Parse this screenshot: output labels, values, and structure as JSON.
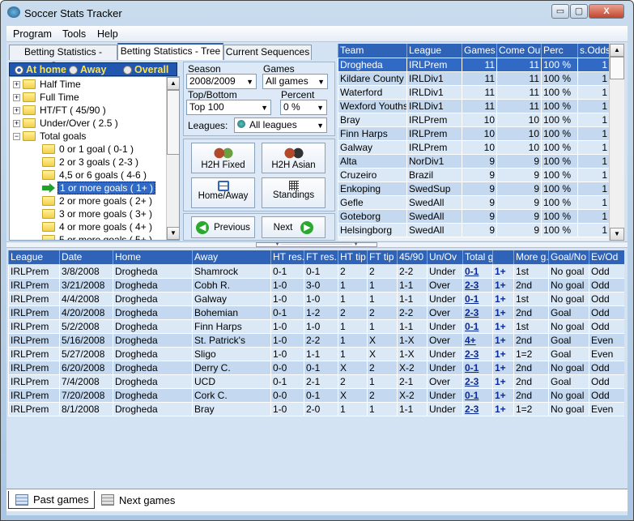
{
  "window": {
    "title": "Soccer Stats Tracker",
    "minimize": "▭",
    "maximize": "▢",
    "close": "X"
  },
  "menu": [
    "Program",
    "Tools",
    "Help"
  ],
  "tabs": [
    "Betting Statistics - Query",
    "Betting Statistics - Tree",
    "Current Sequences"
  ],
  "active_tab": 1,
  "venue": {
    "options": [
      "At home",
      "Away",
      "Overall"
    ],
    "selected": "At home"
  },
  "tree": [
    {
      "label": "Half Time",
      "level": 0,
      "expander": "+"
    },
    {
      "label": "Full Time",
      "level": 0,
      "expander": "+"
    },
    {
      "label": "HT/FT  ( 45/90 )",
      "level": 0,
      "expander": "+"
    },
    {
      "label": "Under/Over ( 2.5 )",
      "level": 0,
      "expander": "+"
    },
    {
      "label": "Total goals",
      "level": 0,
      "expander": "−"
    },
    {
      "label": "0 or 1 goal ( 0-1 )",
      "level": 1
    },
    {
      "label": "2 or 3 goals ( 2-3 )",
      "level": 1
    },
    {
      "label": "4,5 or 6 goals ( 4-6 )",
      "level": 1
    },
    {
      "label": "1 or more goals ( 1+ )",
      "level": 1,
      "selected": true
    },
    {
      "label": "2 or more goals ( 2+ )",
      "level": 1
    },
    {
      "label": "3 or more goals ( 3+ )",
      "level": 1
    },
    {
      "label": "4 or more goals ( 4+ )",
      "level": 1
    },
    {
      "label": "5 or more goals ( 5+ )",
      "level": 1
    }
  ],
  "filters": {
    "season_label": "Season",
    "season": "2008/2009",
    "games_label": "Games",
    "games": "All games",
    "topbottom_label": "Top/Bottom",
    "topbottom": "Top 100",
    "percent_label": "Percent",
    "percent": "0 %",
    "leagues_label": "Leagues:",
    "leagues": "All leagues"
  },
  "buttons": {
    "h2h_fixed": "H2H Fixed",
    "h2h_asian": "H2H Asian",
    "home_away": "Home/Away",
    "standings": "Standings",
    "previous": "Previous",
    "next": "Next"
  },
  "teams_table": {
    "columns": [
      "Team",
      "League",
      "Games",
      "Come Out",
      "Perc",
      "s.Odds"
    ],
    "rows": [
      [
        "Drogheda",
        "IRLPrem",
        "11",
        "11",
        "100 %",
        "1"
      ],
      [
        "Kildare County",
        "IRLDiv1",
        "11",
        "11",
        "100 %",
        "1"
      ],
      [
        "Waterford",
        "IRLDiv1",
        "11",
        "11",
        "100 %",
        "1"
      ],
      [
        "Wexford Youths",
        "IRLDiv1",
        "11",
        "11",
        "100 %",
        "1"
      ],
      [
        "Bray",
        "IRLPrem",
        "10",
        "10",
        "100 %",
        "1"
      ],
      [
        "Finn Harps",
        "IRLPrem",
        "10",
        "10",
        "100 %",
        "1"
      ],
      [
        "Galway",
        "IRLPrem",
        "10",
        "10",
        "100 %",
        "1"
      ],
      [
        "Alta",
        "NorDiv1",
        "9",
        "9",
        "100 %",
        "1"
      ],
      [
        "Cruzeiro",
        "Brazil",
        "9",
        "9",
        "100 %",
        "1"
      ],
      [
        "Enkoping",
        "SwedSup",
        "9",
        "9",
        "100 %",
        "1"
      ],
      [
        "Gefle",
        "SwedAll",
        "9",
        "9",
        "100 %",
        "1"
      ],
      [
        "Goteborg",
        "SwedAll",
        "9",
        "9",
        "100 %",
        "1"
      ],
      [
        "Helsingborg",
        "SwedAll",
        "9",
        "9",
        "100 %",
        "1"
      ]
    ],
    "selected_row": 0
  },
  "games_table": {
    "columns": [
      "League",
      "Date",
      "Home",
      "Away",
      "HT res.",
      "FT res.",
      "HT tip",
      "FT tip",
      "45/90",
      "Un/Ov",
      "Total g",
      "",
      "More g.",
      "Goal/No",
      "Ev/Od"
    ],
    "rows": [
      [
        "IRLPrem",
        "3/8/2008",
        "Drogheda",
        "Shamrock",
        "0-1",
        "0-1",
        "2",
        "2",
        "2-2",
        "Under",
        "0-1",
        "1+",
        "1st",
        "No goal",
        "Odd"
      ],
      [
        "IRLPrem",
        "3/21/2008",
        "Drogheda",
        "Cobh R.",
        "1-0",
        "3-0",
        "1",
        "1",
        "1-1",
        "Over",
        "2-3",
        "1+",
        "2nd",
        "No goal",
        "Odd"
      ],
      [
        "IRLPrem",
        "4/4/2008",
        "Drogheda",
        "Galway",
        "1-0",
        "1-0",
        "1",
        "1",
        "1-1",
        "Under",
        "0-1",
        "1+",
        "1st",
        "No goal",
        "Odd"
      ],
      [
        "IRLPrem",
        "4/20/2008",
        "Drogheda",
        "Bohemian",
        "0-1",
        "1-2",
        "2",
        "2",
        "2-2",
        "Over",
        "2-3",
        "1+",
        "2nd",
        "Goal",
        "Odd"
      ],
      [
        "IRLPrem",
        "5/2/2008",
        "Drogheda",
        "Finn Harps",
        "1-0",
        "1-0",
        "1",
        "1",
        "1-1",
        "Under",
        "0-1",
        "1+",
        "1st",
        "No goal",
        "Odd"
      ],
      [
        "IRLPrem",
        "5/16/2008",
        "Drogheda",
        "St. Patrick's",
        "1-0",
        "2-2",
        "1",
        "X",
        "1-X",
        "Over",
        "4+",
        "1+",
        "2nd",
        "Goal",
        "Even"
      ],
      [
        "IRLPrem",
        "5/27/2008",
        "Drogheda",
        "Sligo",
        "1-0",
        "1-1",
        "1",
        "X",
        "1-X",
        "Under",
        "2-3",
        "1+",
        "1=2",
        "Goal",
        "Even"
      ],
      [
        "IRLPrem",
        "6/20/2008",
        "Drogheda",
        "Derry C.",
        "0-0",
        "0-1",
        "X",
        "2",
        "X-2",
        "Under",
        "0-1",
        "1+",
        "2nd",
        "No goal",
        "Odd"
      ],
      [
        "IRLPrem",
        "7/4/2008",
        "Drogheda",
        "UCD",
        "0-1",
        "2-1",
        "2",
        "1",
        "2-1",
        "Over",
        "2-3",
        "1+",
        "2nd",
        "Goal",
        "Odd"
      ],
      [
        "IRLPrem",
        "7/20/2008",
        "Drogheda",
        "Cork C.",
        "0-0",
        "0-1",
        "X",
        "2",
        "X-2",
        "Under",
        "0-1",
        "1+",
        "2nd",
        "No goal",
        "Odd"
      ],
      [
        "IRLPrem",
        "8/1/2008",
        "Drogheda",
        "Bray",
        "1-0",
        "2-0",
        "1",
        "1",
        "1-1",
        "Under",
        "2-3",
        "1+",
        "1=2",
        "No goal",
        "Even"
      ]
    ]
  },
  "bottom_tabs": [
    "Past games",
    "Next games"
  ],
  "colors": {
    "header": "#2f63b8",
    "row_a": "#dbe8f6",
    "row_b": "#c4d9ef",
    "selected": "#316ac5",
    "radio_text": "#ffe34a"
  }
}
